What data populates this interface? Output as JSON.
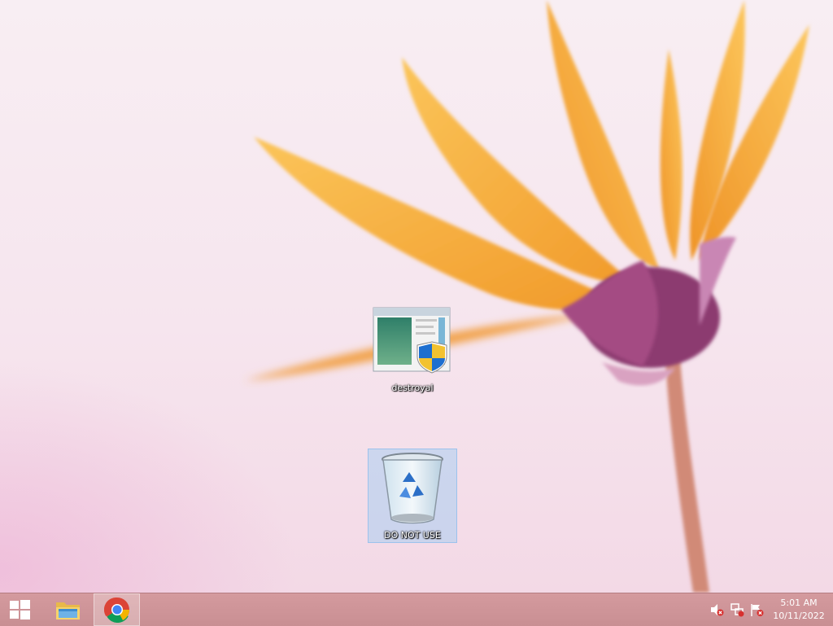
{
  "desktop": {
    "icons": [
      {
        "label": "destroyal",
        "icon": "program-shortcut-icon-with-uac-shield"
      },
      {
        "label": "DO NOT USE",
        "icon": "recycle-bin-icon",
        "selected": true
      }
    ]
  },
  "taskbar": {
    "start": {
      "icon": "windows-logo-icon"
    },
    "pinned": [
      {
        "name": "File Explorer",
        "icon": "file-explorer-icon"
      },
      {
        "name": "Google Chrome",
        "icon": "chrome-icon",
        "active": true
      }
    ],
    "tray": {
      "icons": [
        "volume-muted-icon",
        "network-disconnected-icon",
        "action-center-flag-icon"
      ],
      "time": "5:01 AM",
      "date": "10/11/2022"
    }
  },
  "colors": {
    "taskbar": "#cf9599",
    "wallpaper_petal": "#f7b23c",
    "wallpaper_center": "#8e3d73",
    "selection": "#aacdf0"
  }
}
